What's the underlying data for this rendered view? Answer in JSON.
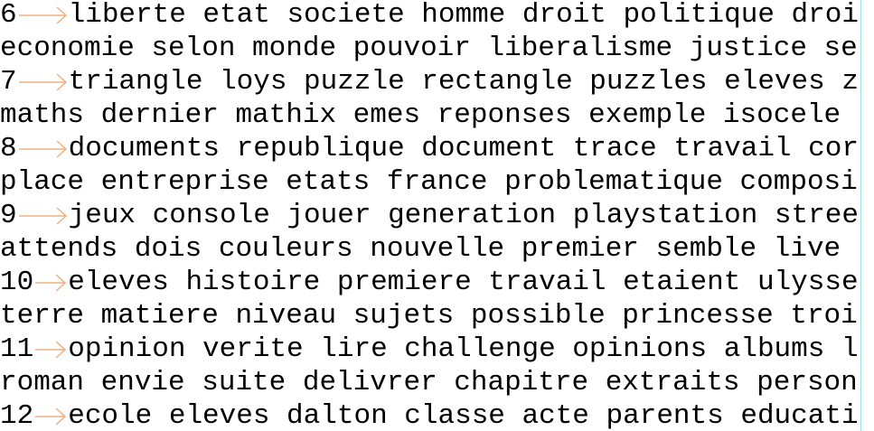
{
  "editor": {
    "colors": {
      "background": "#ffffff",
      "text": "#000000",
      "tab_arrow": "#f0b080",
      "margin_guide": "#9fe3e8"
    },
    "lines": [
      {
        "num": "6",
        "text": "liberte etat societe homme droit politique droi"
      },
      {
        "text": "economie selon monde pouvoir liberalisme justice se"
      },
      {
        "num": "7",
        "text": "triangle loys puzzle rectangle puzzles eleves z"
      },
      {
        "text": "maths dernier mathix emes reponses exemple isocele"
      },
      {
        "num": "8",
        "text": "documents republique document trace travail cor"
      },
      {
        "text": "place entreprise etats france problematique composi"
      },
      {
        "num": "9",
        "text": "jeux console jouer generation playstation stree"
      },
      {
        "text": "attends dois couleurs nouvelle premier semble live"
      },
      {
        "num": "10",
        "text": "eleves histoire premiere travail etaient ulysse"
      },
      {
        "text": "terre matiere niveau sujets possible princesse troi"
      },
      {
        "num": "11",
        "text": "opinion verite lire challenge opinions albums l"
      },
      {
        "text": "roman envie suite delivrer chapitre extraits person"
      },
      {
        "num": "12",
        "text": "ecole eleves dalton classe acte parents educati"
      }
    ]
  }
}
